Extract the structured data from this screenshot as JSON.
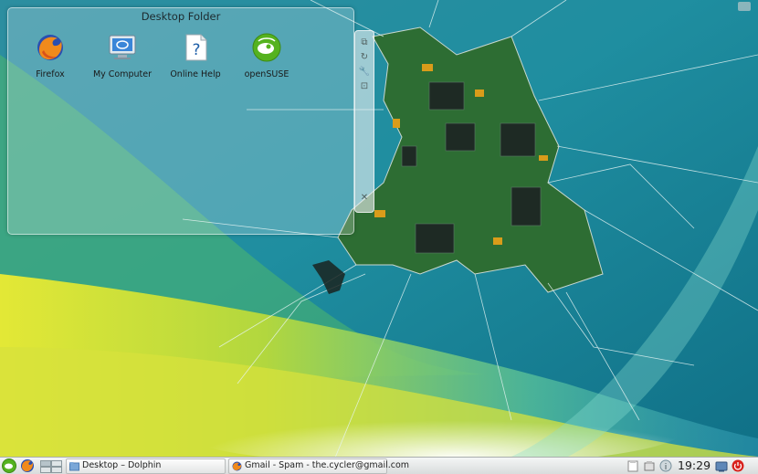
{
  "folder": {
    "title": "Desktop Folder",
    "icons": [
      {
        "label": "Firefox",
        "icon": "firefox-icon"
      },
      {
        "label": "My Computer",
        "icon": "computer-icon"
      },
      {
        "label": "Online Help",
        "icon": "help-icon"
      },
      {
        "label": "openSUSE",
        "icon": "opensuse-icon"
      }
    ]
  },
  "widget_handle": {
    "buttons": [
      "resize-icon",
      "rotate-icon",
      "settings-icon",
      "configure-icon",
      "close-icon"
    ]
  },
  "taskbar": {
    "tasks": [
      {
        "label": "Desktop – Dolphin",
        "icon": "folder-icon"
      },
      {
        "label": "Gmail - Spam - the.cycler@gmail.com",
        "icon": "firefox-icon"
      }
    ],
    "clock": "19:29"
  },
  "colors": {
    "panel_top": "#f4f6f6",
    "panel_bottom": "#d9dcdc",
    "wallpaper_teal": "#1b8c9a",
    "circuit_green": "#2d6d33",
    "opensuse_green": "#55b21f",
    "shutdown_red": "#d8211c"
  }
}
